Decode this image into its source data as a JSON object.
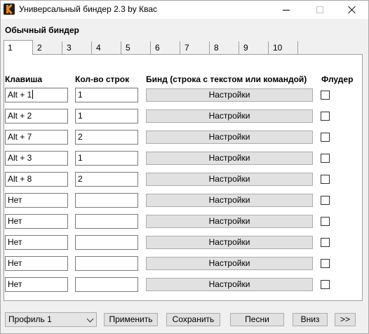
{
  "window": {
    "title": "Универсальный биндер 2.3 by Квас"
  },
  "section_title": "Обычный биндер",
  "tabs": [
    "1",
    "2",
    "3",
    "4",
    "5",
    "6",
    "7",
    "8",
    "9",
    "10"
  ],
  "active_tab": "1",
  "columns": {
    "key": "Клавиша",
    "lines": "Кол-во строк",
    "bind": "Бинд (строка с текстом или командой)",
    "flooder": "Флудер"
  },
  "rows": [
    {
      "key": "Alt + 1",
      "lines": "1",
      "bind_label": "Настройки",
      "flooder": false
    },
    {
      "key": "Alt + 2",
      "lines": "1",
      "bind_label": "Настройки",
      "flooder": false
    },
    {
      "key": "Alt + 7",
      "lines": "2",
      "bind_label": "Настройки",
      "flooder": false
    },
    {
      "key": "Alt + 3",
      "lines": "1",
      "bind_label": "Настройки",
      "flooder": false
    },
    {
      "key": "Alt + 8",
      "lines": "2",
      "bind_label": "Настройки",
      "flooder": false
    },
    {
      "key": "Нет",
      "lines": "",
      "bind_label": "Настройки",
      "flooder": false
    },
    {
      "key": "Нет",
      "lines": "",
      "bind_label": "Настройки",
      "flooder": false
    },
    {
      "key": "Нет",
      "lines": "",
      "bind_label": "Настройки",
      "flooder": false
    },
    {
      "key": "Нет",
      "lines": "",
      "bind_label": "Настройки",
      "flooder": false
    },
    {
      "key": "Нет",
      "lines": "",
      "bind_label": "Настройки",
      "flooder": false
    }
  ],
  "footer": {
    "profile_selected": "Профиль 1",
    "apply_label": "Применить",
    "save_label": "Сохранить",
    "songs_label": "Песни",
    "down_label": "Вниз",
    "more_label": ">>"
  },
  "icons": {
    "app": "app-logo-icon",
    "minimize": "minimize-icon",
    "maximize": "maximize-icon",
    "close": "close-icon",
    "dropdown": "chevron-down-icon"
  }
}
